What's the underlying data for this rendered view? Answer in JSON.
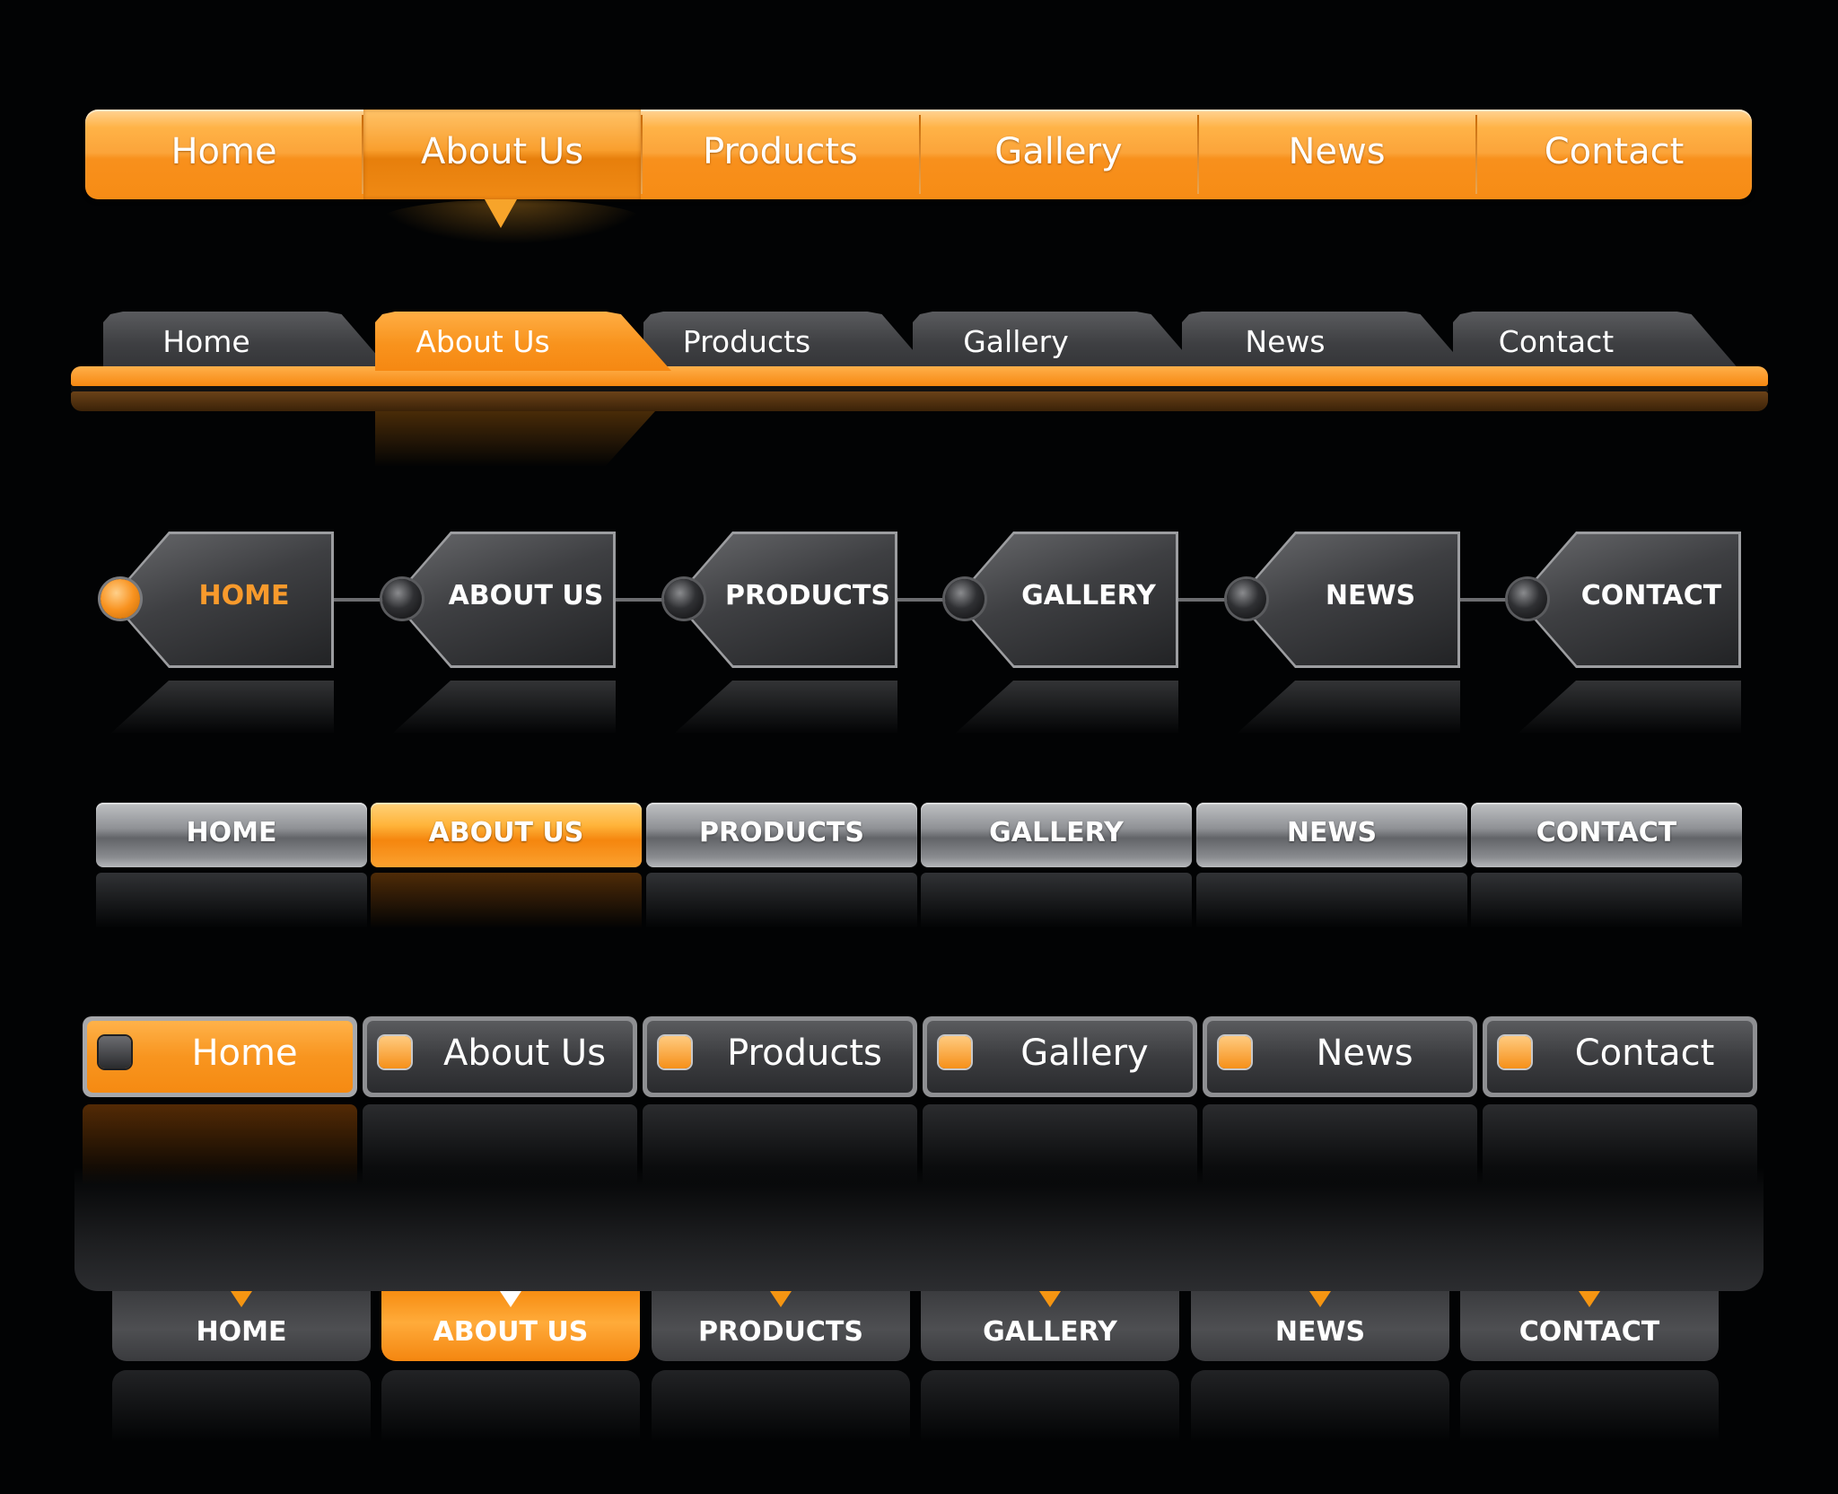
{
  "colors": {
    "accent": "#f8921f",
    "background": "#020304",
    "dark_tab": "#3e3f42",
    "silver": "#8f9195"
  },
  "bar1": {
    "active_index": 1,
    "items": [
      "Home",
      "About Us",
      "Products",
      "Gallery",
      "News",
      "Contact"
    ]
  },
  "bar2": {
    "active_index": 1,
    "items": [
      "Home",
      "About Us",
      "Products",
      "Gallery",
      "News",
      "Contact"
    ]
  },
  "bar3": {
    "active_index": 0,
    "items": [
      "HOME",
      "ABOUT US",
      "PRODUCTS",
      "GALLERY",
      "NEWS",
      "CONTACT"
    ]
  },
  "bar4": {
    "active_index": 1,
    "items": [
      "HOME",
      "ABOUT US",
      "PRODUCTS",
      "GALLERY",
      "NEWS",
      "CONTACT"
    ]
  },
  "bar5": {
    "active_index": 0,
    "items": [
      "Home",
      "About Us",
      "Products",
      "Gallery",
      "News",
      "Contact"
    ]
  },
  "bar6": {
    "active_index": 1,
    "items": [
      "HOME",
      "ABOUT US",
      "PRODUCTS",
      "GALLERY",
      "NEWS",
      "CONTACT"
    ]
  }
}
